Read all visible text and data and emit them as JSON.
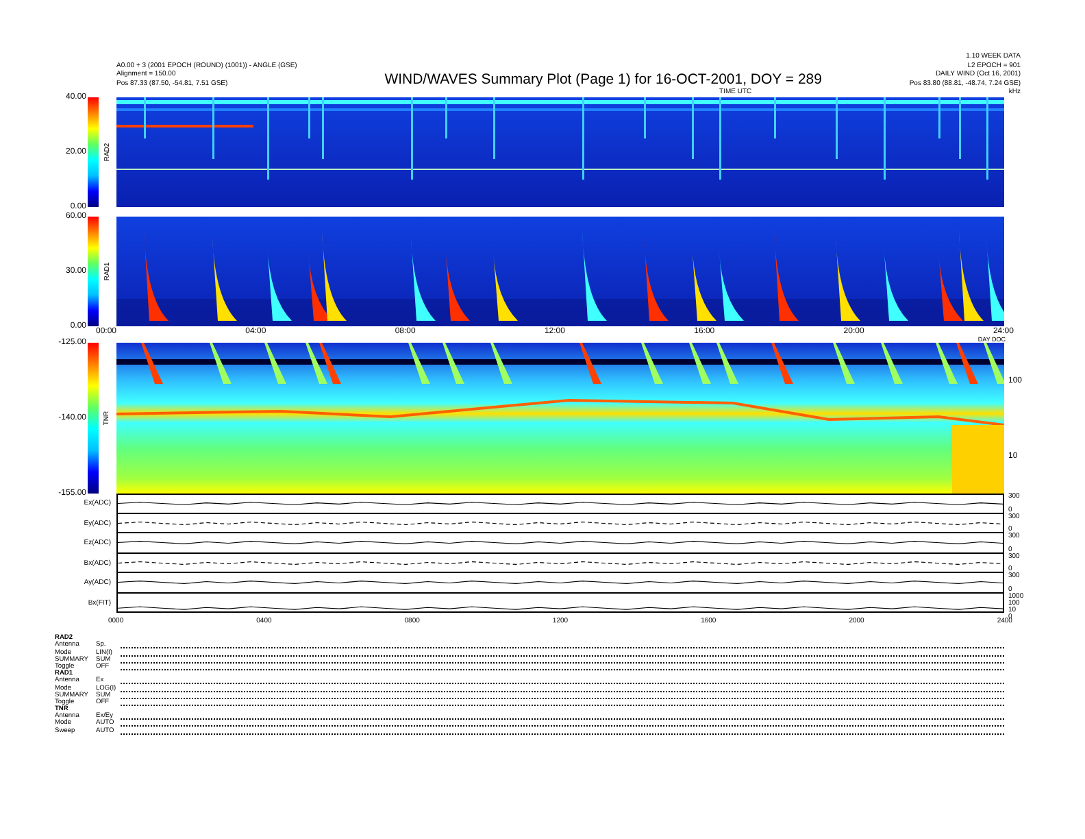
{
  "header": {
    "left_lines": [
      "A0.00 + 3 (2001 EPOCH (ROUND) (1001)) - ANGLE (GSE)",
      "Alignment = 150.00",
      "Pos    87.33 (87.50, -54.81, 7.51 GSE)"
    ],
    "title": "WIND/WAVES Summary Plot (Page 1) for 16-OCT-2001, DOY = 289",
    "right_lines": [
      "1.10 WEEK DATA",
      "L2 EPOCH = 901",
      "DAILY WIND (Oct 16, 2001)",
      "Pos    83.80 (88.81, -48.74, 7.24 GSE)"
    ],
    "time_label": "TIME UTC",
    "unit_label": "kHz"
  },
  "spectrograms": [
    {
      "label": "RAD2",
      "ticks": [
        "40.00",
        "20.00",
        "0.00"
      ]
    },
    {
      "label": "RAD1",
      "ticks": [
        "60.00",
        "30.00",
        "0.00"
      ]
    }
  ],
  "time_axis": {
    "labels": [
      "00:00",
      "04:00",
      "08:00",
      "12:00",
      "16:00",
      "20:00",
      "24:00"
    ],
    "note": "DAY DOC"
  },
  "tnr": {
    "label": "TNR",
    "ticks": [
      "-125.00",
      "-140.00",
      "-155.00"
    ],
    "right_ticks": [
      "100",
      "10"
    ]
  },
  "strips": [
    {
      "label": "Ex(ADC)",
      "dashed": false,
      "right_ticks": [
        "300",
        "0"
      ]
    },
    {
      "label": "Ey(ADC)",
      "dashed": true,
      "right_ticks": [
        "300",
        "0"
      ]
    },
    {
      "label": "Ez(ADC)",
      "dashed": false,
      "right_ticks": [
        "300",
        "0"
      ]
    },
    {
      "label": "Bx(ADC)",
      "dashed": true,
      "right_ticks": [
        "300",
        "0"
      ]
    },
    {
      "label": "Ay(ADC)",
      "dashed": false,
      "right_ticks": [
        "300",
        "0"
      ]
    },
    {
      "label": "Bx(FIT)",
      "dashed": false,
      "right_ticks": [
        "1000",
        "100",
        "10",
        "0"
      ]
    }
  ],
  "bottom_axis": [
    "0000",
    "0400",
    "0800",
    "1200",
    "1600",
    "2000",
    "2400"
  ],
  "params": [
    {
      "kind": "header",
      "name": "RAD2"
    },
    {
      "kind": "param",
      "name": "Antenna",
      "value": "Sp."
    },
    {
      "kind": "param",
      "name": "Mode",
      "value": "LIN(I)"
    },
    {
      "kind": "param",
      "name": "SUMMARY",
      "value": "SUM"
    },
    {
      "kind": "param",
      "name": "Toggle",
      "value": "OFF"
    },
    {
      "kind": "header",
      "name": "RAD1"
    },
    {
      "kind": "param",
      "name": "Antenna",
      "value": "Ex"
    },
    {
      "kind": "param",
      "name": "Mode",
      "value": "LOG(I)"
    },
    {
      "kind": "param",
      "name": "SUMMARY",
      "value": "SUM"
    },
    {
      "kind": "param",
      "name": "Toggle",
      "value": "OFF"
    },
    {
      "kind": "header",
      "name": "TNR"
    },
    {
      "kind": "param",
      "name": "Antenna",
      "value": "Ex/Ey"
    },
    {
      "kind": "param",
      "name": "Mode",
      "value": "AUTO"
    },
    {
      "kind": "param",
      "name": "Sweep",
      "value": "AUTO"
    }
  ]
}
